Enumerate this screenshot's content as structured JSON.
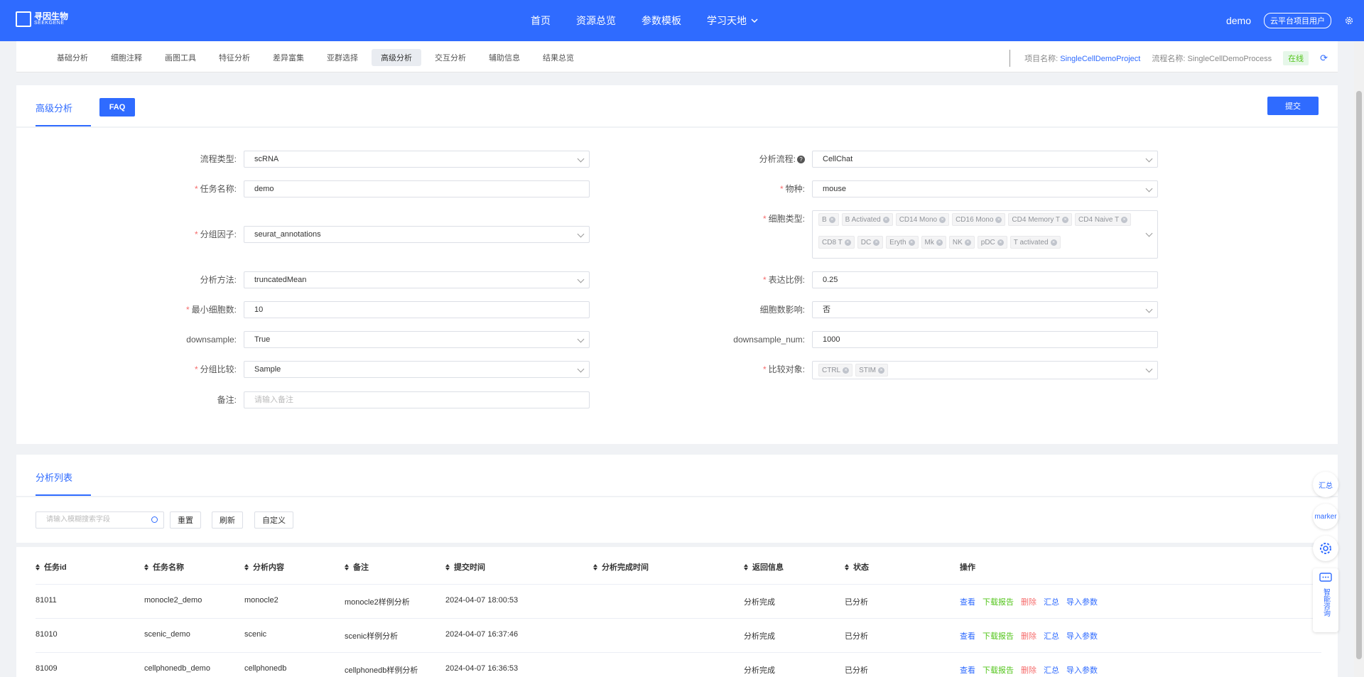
{
  "topnav": {
    "logo_text": "寻因生物",
    "logo_sub": "SEEKGENE",
    "links": [
      "首页",
      "资源总览",
      "参数模板",
      "学习天地"
    ],
    "user": "demo",
    "user_badge": "云平台项目用户"
  },
  "subnav": {
    "tabs": [
      "基础分析",
      "细胞注释",
      "画图工具",
      "特征分析",
      "差异富集",
      "亚群选择",
      "高级分析",
      "交互分析",
      "辅助信息",
      "结果总览"
    ],
    "active_tab": "高级分析",
    "project_label": "项目名称:",
    "project_value": "SingleCellDemoProject",
    "process_label": "流程名称:",
    "process_value": "SingleCellDemoProcess",
    "status": "在线"
  },
  "form_panel": {
    "tab_label": "高级分析",
    "faq_label": "FAQ",
    "submit_label": "提交",
    "left": [
      {
        "label": "流程类型:",
        "required": false,
        "value": "scRNA",
        "type": "select"
      },
      {
        "label": "任务名称:",
        "required": true,
        "value": "demo",
        "type": "input"
      },
      {
        "label": "分组因子:",
        "required": true,
        "value": "seurat_annotations",
        "type": "select"
      },
      {
        "label": "分析方法:",
        "required": false,
        "value": "truncatedMean",
        "type": "select"
      },
      {
        "label": "最小细胞数:",
        "required": true,
        "value": "10",
        "type": "input"
      },
      {
        "label": "downsample:",
        "required": false,
        "value": "True",
        "type": "select"
      },
      {
        "label": "分组比较:",
        "required": true,
        "value": "Sample",
        "type": "select"
      },
      {
        "label": "备注:",
        "required": false,
        "placeholder": "请输入备注",
        "type": "input"
      }
    ],
    "right": [
      {
        "label": "分析流程:",
        "required": false,
        "value": "CellChat",
        "type": "select",
        "help": true
      },
      {
        "label": "物种:",
        "required": true,
        "value": "mouse",
        "type": "select"
      },
      {
        "label": "细胞类型:",
        "required": true,
        "type": "multi",
        "tags": [
          "B",
          "B Activated",
          "CD14 Mono",
          "CD16 Mono",
          "CD4 Memory T",
          "CD4 Naive T",
          "CD8 T",
          "DC",
          "Eryth",
          "Mk",
          "NK",
          "pDC",
          "T activated"
        ]
      },
      {
        "label": "表达比例:",
        "required": true,
        "value": "0.25",
        "type": "input"
      },
      {
        "label": "细胞数影响:",
        "required": false,
        "value": "否",
        "type": "select"
      },
      {
        "label": "downsample_num:",
        "required": false,
        "value": "1000",
        "type": "input"
      },
      {
        "label": "比较对象:",
        "required": true,
        "type": "multi",
        "tags": [
          "CTRL",
          "STIM"
        ]
      }
    ]
  },
  "list_panel": {
    "tab_label": "分析列表",
    "search_placeholder": "请输入模糊搜索字段",
    "buttons": [
      "重置",
      "刷新",
      "自定义"
    ],
    "columns": [
      "任务id",
      "任务名称",
      "分析内容",
      "备注",
      "提交时间",
      "分析完成时间",
      "返回信息",
      "状态",
      "操作"
    ],
    "rows": [
      {
        "id": "81011",
        "name": "monocle2_demo",
        "content": "monocle2",
        "note": "monocle2样例分析",
        "submit": "2024-04-07 18:00:53",
        "finish": "",
        "msg": "分析完成",
        "status": "已分析"
      },
      {
        "id": "81010",
        "name": "scenic_demo",
        "content": "scenic",
        "note": "scenic样例分析",
        "submit": "2024-04-07 16:37:46",
        "finish": "",
        "msg": "分析完成",
        "status": "已分析"
      },
      {
        "id": "81009",
        "name": "cellphonedb_demo",
        "content": "cellphonedb",
        "note": "cellphonedb样例分析",
        "submit": "2024-04-07 16:36:53",
        "finish": "",
        "msg": "分析完成",
        "status": "已分析"
      }
    ],
    "ops": [
      "查看",
      "下载报告",
      "删除",
      "汇总",
      "导入参数"
    ]
  },
  "float": {
    "summary": "汇总",
    "marker": "marker",
    "consult": "智能咨询"
  }
}
